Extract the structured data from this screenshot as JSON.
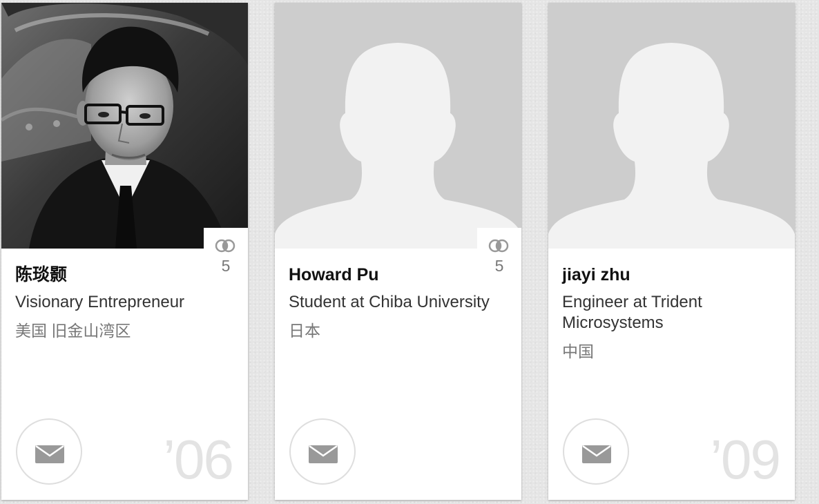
{
  "cards": [
    {
      "name": "陈琰颢",
      "headline": "Visionary Entrepreneur",
      "location": "美国 旧金山湾区",
      "shared_count": "5",
      "class_year": "’06",
      "photo": "person-photo",
      "message_icon": "envelope-icon"
    },
    {
      "name": "Howard Pu",
      "headline": "Student at Chiba University",
      "location": "日本",
      "shared_count": "5",
      "class_year": "",
      "photo": "default-avatar-silhouette",
      "message_icon": "envelope-icon"
    },
    {
      "name": "jiayi zhu",
      "headline": "Engineer at Trident Microsystems",
      "location": "中国",
      "shared_count": "",
      "class_year": "’09",
      "photo": "default-avatar-silhouette",
      "message_icon": "envelope-icon"
    }
  ],
  "colors": {
    "page_background": "#e5e5e5",
    "card_background": "#ffffff",
    "avatar_background": "#cdcdcd",
    "avatar_silhouette": "#f2f2f2",
    "year_text": "#e3e3e3",
    "icon_gray": "#999999"
  }
}
